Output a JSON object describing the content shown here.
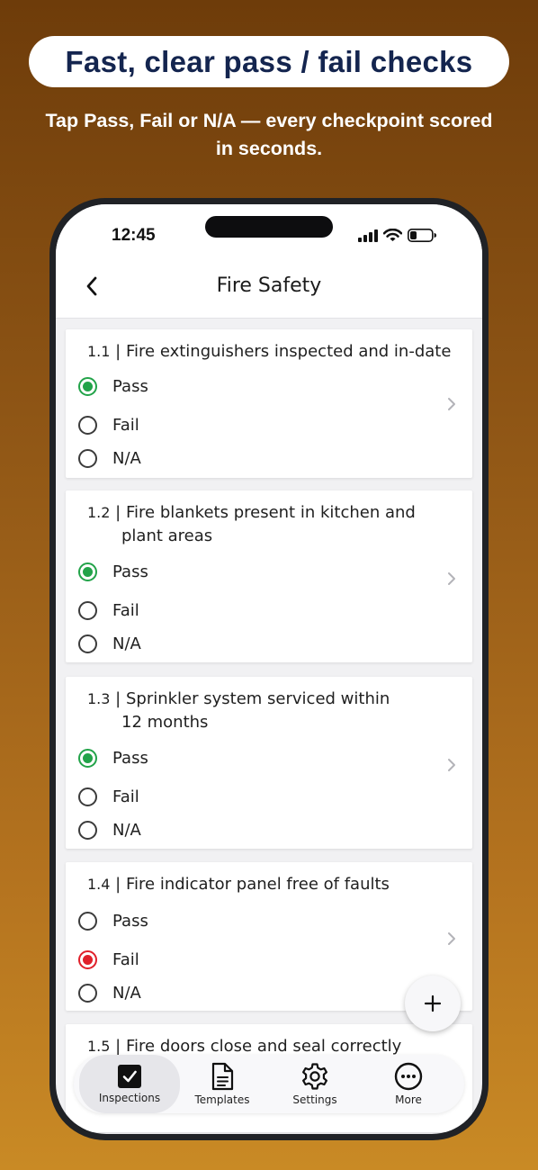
{
  "promo": {
    "headline": "Fast, clear pass / fail checks",
    "subtitle": "Tap Pass, Fail or N/A — every checkpoint scored in seconds."
  },
  "status_bar": {
    "time": "12:45",
    "icons": [
      "signal-icon",
      "wifi-icon",
      "battery-icon"
    ]
  },
  "header": {
    "title": "Fire Safety",
    "back_icon": "chevron-left-icon"
  },
  "checkpoints": [
    {
      "number": "1.1",
      "separator": " | ",
      "text_line1": "Fire extinguishers inspected and in-date",
      "text_line2": "",
      "options": {
        "pass": "Pass",
        "fail": "Fail",
        "na": "N/A"
      },
      "selected": "Pass"
    },
    {
      "number": "1.2",
      "separator": " | ",
      "text_line1": "Fire blankets present in kitchen and",
      "text_line2": "plant areas",
      "options": {
        "pass": "Pass",
        "fail": "Fail",
        "na": "N/A"
      },
      "selected": "Pass"
    },
    {
      "number": "1.3",
      "separator": " | ",
      "text_line1": "Sprinkler system serviced within",
      "text_line2": "12 months",
      "options": {
        "pass": "Pass",
        "fail": "Fail",
        "na": "N/A"
      },
      "selected": "Pass"
    },
    {
      "number": "1.4",
      "separator": " | ",
      "text_line1": "Fire indicator panel free of faults",
      "text_line2": "",
      "options": {
        "pass": "Pass",
        "fail": "Fail",
        "na": "N/A"
      },
      "selected": "Fail"
    },
    {
      "number": "1.5",
      "separator": " | ",
      "text_line1": "Fire doors close and seal correctly",
      "text_line2": ""
    }
  ],
  "fab": {
    "icon": "plus-icon"
  },
  "tabbar": {
    "active": "Inspections",
    "tabs": [
      {
        "label": "Inspections",
        "icon": "checkbox-icon"
      },
      {
        "label": "Templates",
        "icon": "document-icon"
      },
      {
        "label": "Settings",
        "icon": "gear-icon"
      },
      {
        "label": "More",
        "icon": "more-icon"
      }
    ]
  },
  "colors": {
    "pass": "#22a349",
    "fail": "#e0202a",
    "headline": "#14254f",
    "background_top": "#6e3c0a",
    "background_bottom": "#c98a25"
  }
}
